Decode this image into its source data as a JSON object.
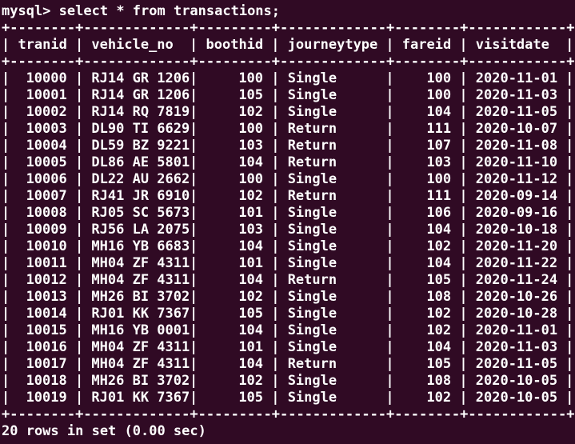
{
  "prompt": "mysql>",
  "command": "select * from transactions;",
  "table": {
    "border": "+--------+-------------+---------+-------------+--------+------------+",
    "columns": [
      "tranid",
      "vehicle_no",
      "boothid",
      "journeytype",
      "fareid",
      "visitdate"
    ],
    "rows": [
      [
        "10000",
        "RJ14 GR 1206",
        "100",
        "Single",
        "100",
        "2020-11-01"
      ],
      [
        "10001",
        "RJ14 GR 1206",
        "105",
        "Single",
        "100",
        "2020-11-03"
      ],
      [
        "10002",
        "RJ14 RQ 7819",
        "102",
        "Single",
        "104",
        "2020-11-05"
      ],
      [
        "10003",
        "DL90 TI 6629",
        "100",
        "Return",
        "111",
        "2020-10-07"
      ],
      [
        "10004",
        "DL59 BZ 9221",
        "103",
        "Return",
        "107",
        "2020-11-08"
      ],
      [
        "10005",
        "DL86 AE 5801",
        "104",
        "Return",
        "103",
        "2020-11-10"
      ],
      [
        "10006",
        "DL22 AU 2662",
        "100",
        "Single",
        "100",
        "2020-11-12"
      ],
      [
        "10007",
        "RJ41 JR 6910",
        "102",
        "Return",
        "111",
        "2020-09-14"
      ],
      [
        "10008",
        "RJ05 SC 5673",
        "101",
        "Single",
        "106",
        "2020-09-16"
      ],
      [
        "10009",
        "RJ56 LA 2075",
        "103",
        "Single",
        "104",
        "2020-10-18"
      ],
      [
        "10010",
        "MH16 YB 6683",
        "104",
        "Single",
        "102",
        "2020-11-20"
      ],
      [
        "10011",
        "MH04 ZF 4311",
        "101",
        "Single",
        "104",
        "2020-11-22"
      ],
      [
        "10012",
        "MH04 ZF 4311",
        "104",
        "Return",
        "105",
        "2020-11-24"
      ],
      [
        "10013",
        "MH26 BI 3702",
        "102",
        "Single",
        "108",
        "2020-10-26"
      ],
      [
        "10014",
        "RJ01 KK 7367",
        "105",
        "Single",
        "102",
        "2020-10-28"
      ],
      [
        "10015",
        "MH16 YB 0001",
        "104",
        "Single",
        "102",
        "2020-11-01"
      ],
      [
        "10016",
        "MH04 ZF 4311",
        "101",
        "Single",
        "104",
        "2020-11-03"
      ],
      [
        "10017",
        "MH04 ZF 4311",
        "104",
        "Return",
        "105",
        "2020-11-05"
      ],
      [
        "10018",
        "MH26 BI 3702",
        "102",
        "Single",
        "108",
        "2020-10-05"
      ],
      [
        "10019",
        "RJ01 KK 7367",
        "105",
        "Single",
        "102",
        "2020-10-05"
      ]
    ]
  },
  "result": "20 rows in set (0.00 sec)",
  "colors": {
    "background": "#300a24",
    "text": "#ffffff"
  }
}
